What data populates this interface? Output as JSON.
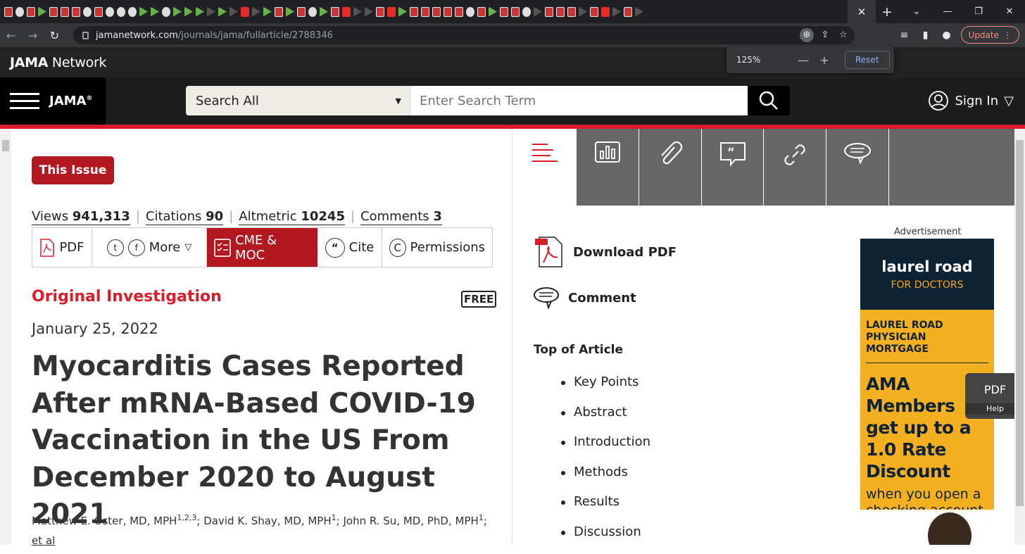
{
  "browser": {
    "url_host": "jamanetwork.com",
    "url_path": "/journals/jama/fullarticle/2788346",
    "update_label": "Update",
    "zoom_level": "125%",
    "zoom_reset": "Reset",
    "zoom_minus": "—",
    "zoom_plus": "+"
  },
  "site": {
    "network_logo_a": "JAMA",
    "network_logo_b": " Network",
    "journal": "JAMA",
    "search_scope": "Search All",
    "search_placeholder": "Enter Search Term",
    "sign_in": "Sign In"
  },
  "article": {
    "issue_button": "This Issue",
    "metrics": [
      {
        "label": "Views",
        "value": "941,313"
      },
      {
        "label": "Citations",
        "value": "90"
      },
      {
        "label": "Altmetric",
        "value": "10245"
      },
      {
        "label": "Comments",
        "value": "3"
      }
    ],
    "actions": {
      "pdf": "PDF",
      "more": "More",
      "cme": "CME & MOC",
      "cite": "Cite",
      "permissions": "Permissions"
    },
    "type": "Original Investigation",
    "free_badge": "FREE",
    "date": "January 25, 2022",
    "title": "Myocarditis Cases Reported After mRNA-Based COVID-19 Vaccination in the US From December 2020 to August 2021",
    "authors": [
      {
        "name": "Matthew E. Oster, MD, MPH",
        "sup": "1,2,3",
        "sep": "; "
      },
      {
        "name": "David K. Shay, MD, MPH",
        "sup": "1",
        "sep": "; "
      },
      {
        "name": "John R. Su, MD, PhD, MPH",
        "sup": "1",
        "sep": ";"
      }
    ],
    "et_al": "et al"
  },
  "sidebar": {
    "download_pdf": "Download PDF",
    "comment": "Comment",
    "top_of_article": "Top of Article",
    "toc": [
      "Key Points",
      "Abstract",
      "Introduction",
      "Methods",
      "Results",
      "Discussion"
    ]
  },
  "ad": {
    "label": "Advertisement",
    "brand": "laurel road",
    "brand_sub": "FOR DOCTORS",
    "headline1": "LAUREL ROAD PHYSICIAN MORTGAGE",
    "headline2": "AMA Members get up to a 1.0 Rate Discount",
    "body": "when you open a checking account during refinancing."
  },
  "pdf_widget": {
    "label": "PDF",
    "help": "Help"
  },
  "colors": {
    "brand_red": "#b1181f",
    "accent_red": "#d71e2a",
    "ad_yellow": "#f5b022",
    "ad_navy": "#0d2233"
  }
}
